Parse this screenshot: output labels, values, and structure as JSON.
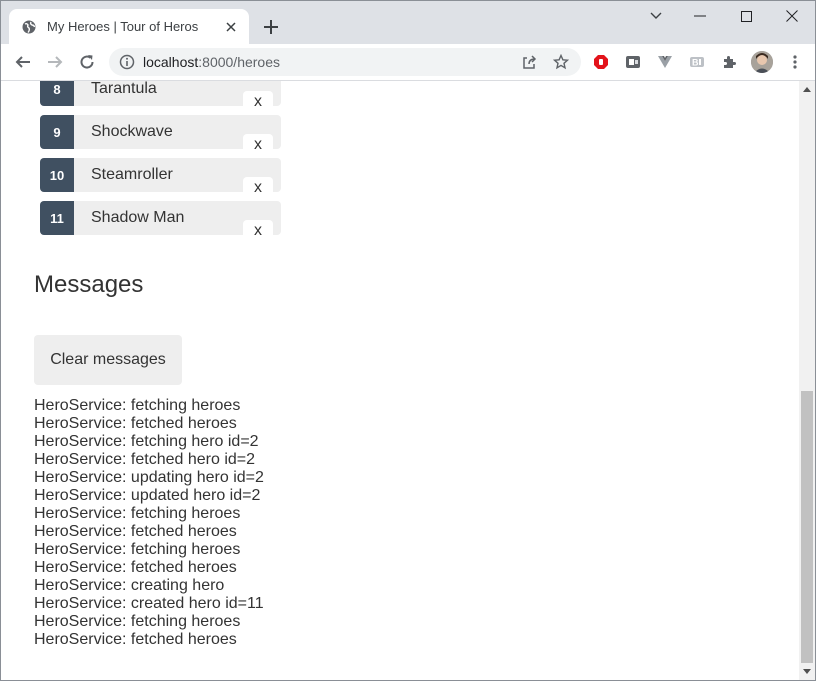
{
  "browser": {
    "tab": {
      "title": "My Heroes | Tour of Heros",
      "favicon": "globe-icon"
    },
    "address": {
      "host": "localhost",
      "path": ":8000/heroes"
    },
    "toolbar_icons": [
      "back-icon",
      "forward-icon",
      "reload-icon",
      "info-icon",
      "share-icon",
      "star-icon"
    ],
    "extension_icons": [
      "ublock-icon",
      "extension-icon",
      "vue-devtools-icon",
      "extension-icon",
      "puzzle-icon"
    ],
    "colors": {
      "tabstrip": "#dee1e6",
      "omnibox": "#f1f3f4"
    }
  },
  "heroes": [
    {
      "id": "8",
      "name": "Tarantula",
      "delete_label": "x"
    },
    {
      "id": "9",
      "name": "Shockwave",
      "delete_label": "x"
    },
    {
      "id": "10",
      "name": "Steamroller",
      "delete_label": "x"
    },
    {
      "id": "11",
      "name": "Shadow Man",
      "delete_label": "x"
    }
  ],
  "messages": {
    "title": "Messages",
    "clear_label": "Clear messages",
    "lines": [
      "HeroService: fetching heroes",
      "HeroService: fetched heroes",
      "HeroService: fetching hero id=2",
      "HeroService: fetched hero id=2",
      "HeroService: updating hero id=2",
      "HeroService: updated hero id=2",
      "HeroService: fetching heroes",
      "HeroService: fetched heroes",
      "HeroService: fetching heroes",
      "HeroService: fetched heroes",
      "HeroService: creating hero",
      "HeroService: created hero id=11",
      "HeroService: fetching heroes",
      "HeroService: fetched heroes"
    ]
  },
  "colors": {
    "badge": "#405061",
    "item": "#eeeeee",
    "text": "#333333"
  }
}
